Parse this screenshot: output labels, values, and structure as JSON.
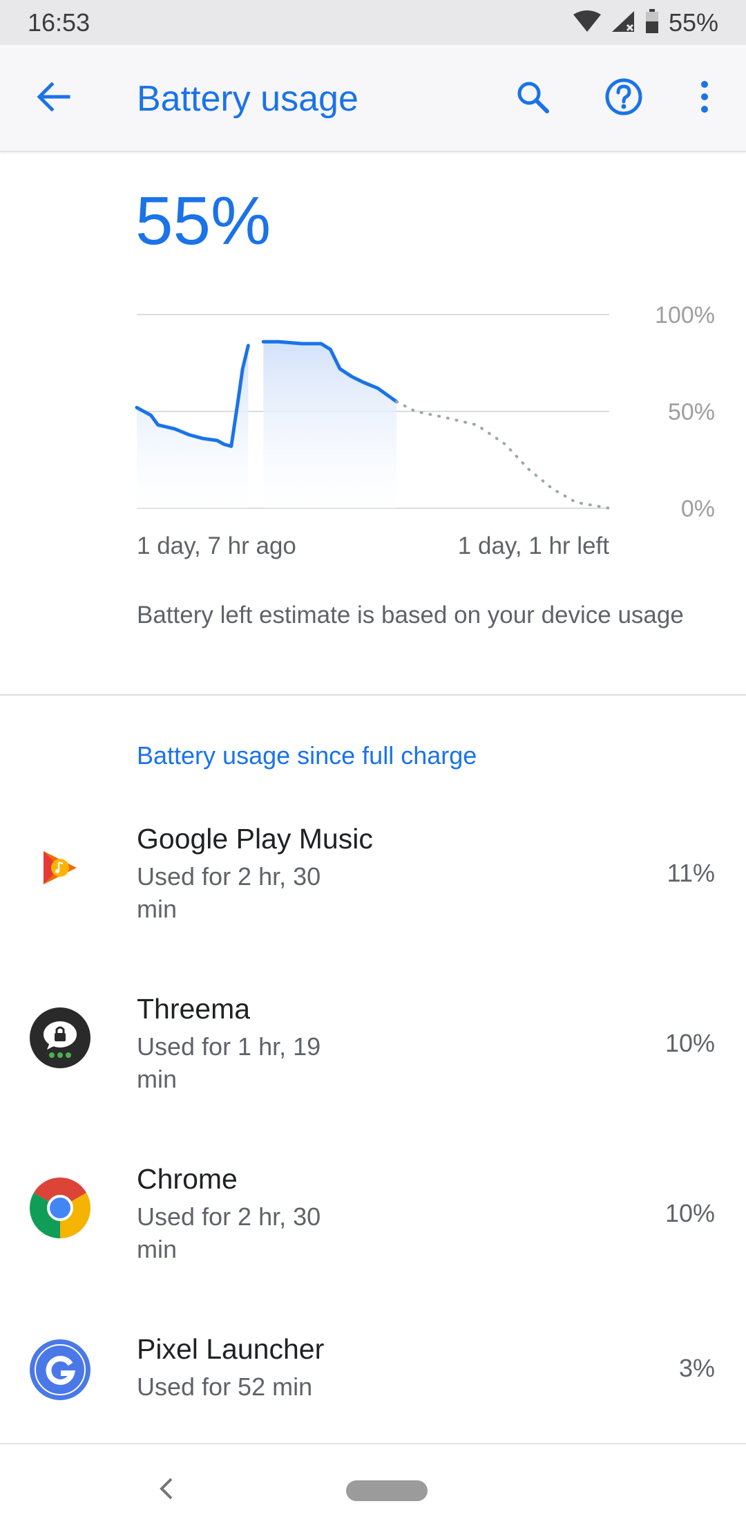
{
  "status_bar": {
    "time": "16:53",
    "battery_text": "55%",
    "icons": [
      "wifi-icon",
      "cell-signal-icon",
      "battery-icon"
    ]
  },
  "app_bar": {
    "title": "Battery usage",
    "icons": [
      "back-arrow-icon",
      "search-icon",
      "help-icon",
      "more-vert-icon"
    ]
  },
  "battery_level": "55%",
  "chart_data": {
    "type": "line",
    "y_ticks": [
      "100%",
      "50%",
      "0%"
    ],
    "ylim": [
      0,
      100
    ],
    "x_start_label": "1 day, 7 hr ago",
    "x_end_label": "1 day, 1 hr left",
    "grid": true,
    "series": [
      {
        "x": [
          0,
          0.03,
          0.045,
          0.08,
          0.11,
          0.14,
          0.17,
          0.185,
          0.2,
          0.214,
          0.224,
          0.236
        ],
        "values": [
          52,
          48,
          43,
          41,
          38,
          36,
          35,
          33,
          32,
          55,
          72,
          84
        ],
        "style": "solid",
        "filled": true
      },
      {
        "x": [
          0.268,
          0.3,
          0.35,
          0.39,
          0.41,
          0.43,
          0.455,
          0.48,
          0.51,
          0.55
        ],
        "values": [
          86,
          86,
          85,
          85,
          82,
          72,
          68,
          65,
          62,
          55
        ],
        "style": "solid",
        "filled": true
      },
      {
        "x": [
          0.55,
          0.59,
          0.65,
          0.72,
          0.78,
          0.83,
          0.88,
          0.93,
          1.0
        ],
        "values": [
          55,
          50,
          47,
          43,
          33,
          20,
          10,
          3,
          0
        ],
        "style": "dotted",
        "filled": false
      }
    ],
    "colors": {
      "line": "#1a73e8",
      "fill": "#d6e4fa",
      "projection": "#9aa8a8",
      "grid": "#dadce0",
      "tick_label": "#9e9e9e"
    }
  },
  "estimate_note": "Battery left estimate is based on your device usage",
  "section_header": "Battery usage since full charge",
  "apps": [
    {
      "name": "Google Play Music",
      "used": "Used for 2 hr, 30 min",
      "percent": "11%",
      "icon": "google-play-music-icon"
    },
    {
      "name": "Threema",
      "used": "Used for 1 hr, 19 min",
      "percent": "10%",
      "icon": "threema-icon"
    },
    {
      "name": "Chrome",
      "used": "Used for 2 hr, 30 min",
      "percent": "10%",
      "icon": "chrome-icon"
    },
    {
      "name": "Pixel Launcher",
      "used": "Used for 52 min",
      "percent": "3%",
      "icon": "pixel-launcher-icon"
    }
  ],
  "nav_bar": {
    "icons": [
      "nav-back-icon",
      "home-pill-icon"
    ]
  }
}
